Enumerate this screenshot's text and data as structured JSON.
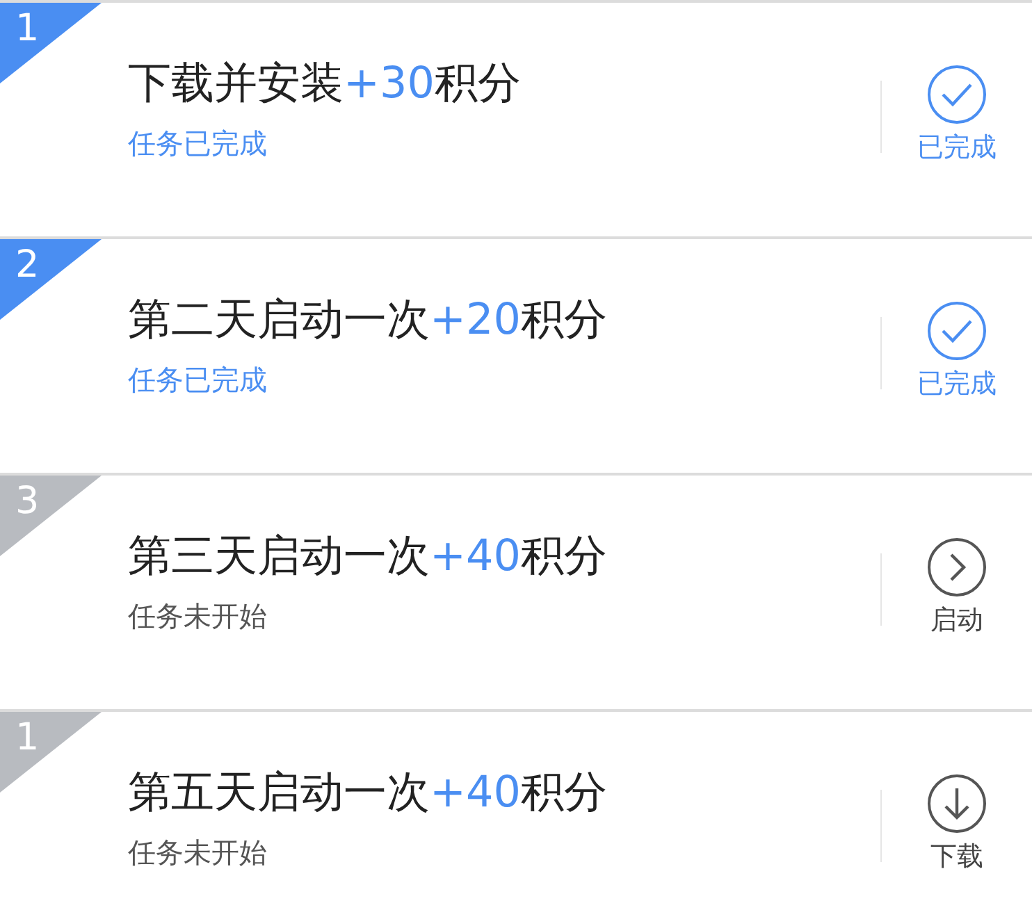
{
  "tasks": [
    {
      "rank": "1",
      "task": "下载并安装",
      "points": "+30",
      "unit": "积分",
      "status": "任务已完成",
      "completed": true,
      "action": {
        "kind": "done",
        "label": "已完成"
      }
    },
    {
      "rank": "2",
      "task": "第二天启动一次",
      "points": "+20",
      "unit": "积分",
      "status": "任务已完成",
      "completed": true,
      "action": {
        "kind": "done",
        "label": "已完成"
      }
    },
    {
      "rank": "3",
      "task": "第三天启动一次",
      "points": "+40",
      "unit": "积分",
      "status": "任务未开始",
      "completed": false,
      "action": {
        "kind": "launch",
        "label": "启动"
      }
    },
    {
      "rank": "1",
      "task": "第五天启动一次",
      "points": "+40",
      "unit": "积分",
      "status": "任务未开始",
      "completed": false,
      "action": {
        "kind": "download",
        "label": "下载"
      }
    }
  ]
}
